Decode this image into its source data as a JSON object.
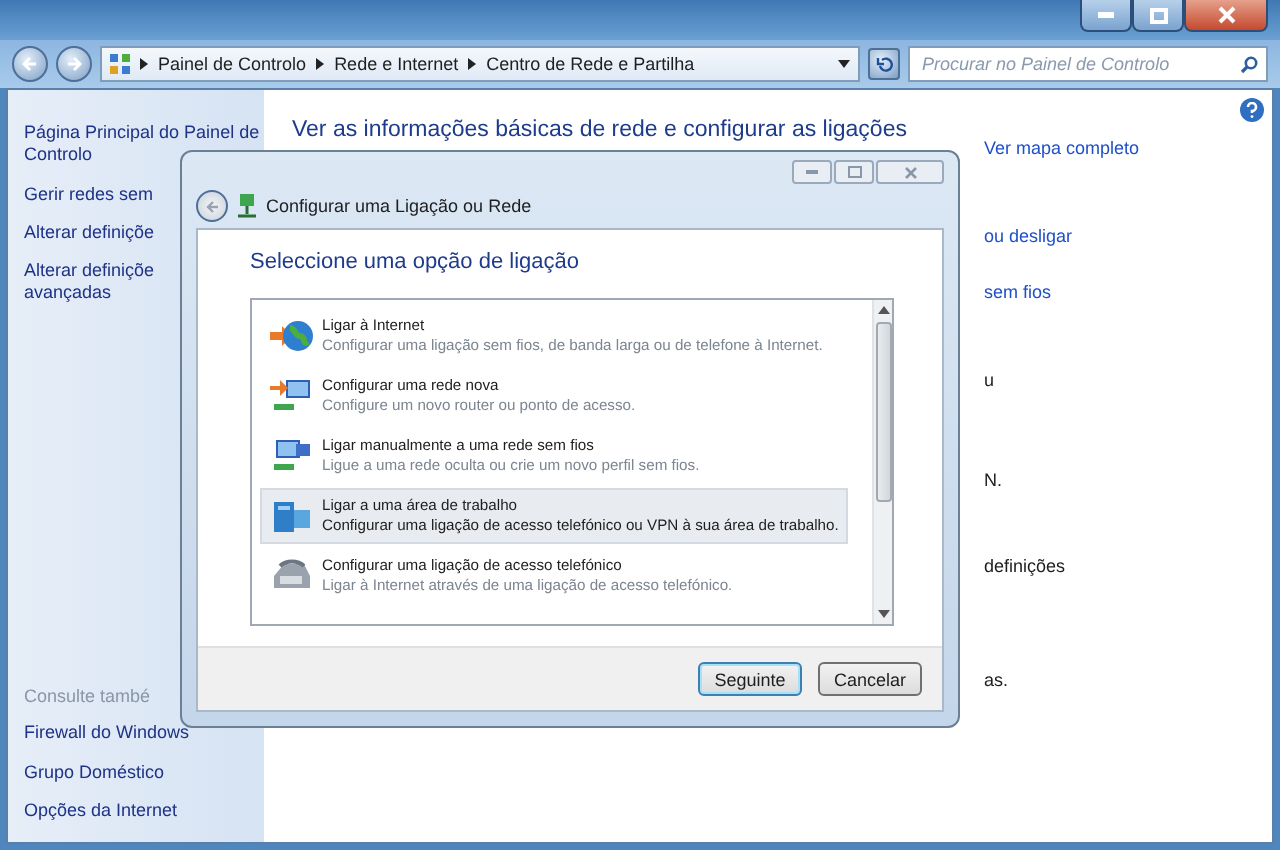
{
  "address_bar": {
    "breadcrumbs": [
      "Painel de Controlo",
      "Rede e Internet",
      "Centro de Rede e Partilha"
    ],
    "search": {
      "placeholder": "Procurar no Painel de Controlo"
    }
  },
  "sidebar": {
    "items": [
      "Página Principal do Painel de Controlo",
      "Gerir redes sem",
      "Alterar definiçõe",
      "Alterar definiçõe avançadas"
    ],
    "see_also": {
      "title": "Consulte també",
      "items": [
        "Firewall do Windows",
        "Grupo Doméstico",
        "Opções da Internet"
      ]
    }
  },
  "main": {
    "heading": "Ver as informações básicas de rede e configurar as ligações",
    "fragments": [
      {
        "text": "Ver mapa completo",
        "kind": "link"
      },
      {
        "text": "ou desligar",
        "kind": "link"
      },
      {
        "text": "sem fios",
        "kind": "link"
      },
      {
        "text": "u",
        "kind": "text"
      },
      {
        "text": "N.",
        "kind": "text"
      },
      {
        "text": "definições",
        "kind": "text"
      },
      {
        "text": "as.",
        "kind": "text"
      }
    ]
  },
  "dialog": {
    "title": "Configurar uma Ligação ou Rede",
    "heading": "Seleccione uma opção de ligação",
    "options": [
      {
        "title": "Ligar à Internet",
        "description": "Configurar uma ligação sem fios, de banda larga ou de telefone à Internet.",
        "selected": false
      },
      {
        "title": "Configurar uma rede nova",
        "description": "Configure um novo router ou ponto de acesso.",
        "selected": false
      },
      {
        "title": "Ligar manualmente a uma rede sem fios",
        "description": "Ligue a uma rede oculta ou crie um novo perfil sem fios.",
        "selected": false
      },
      {
        "title": "Ligar a uma área de trabalho",
        "description": "Configurar uma ligação de acesso telefónico ou VPN à sua área de trabalho.",
        "selected": true
      },
      {
        "title": "Configurar uma ligação de acesso telefónico",
        "description": "Ligar à Internet através de uma ligação de acesso telefónico.",
        "selected": false
      }
    ],
    "buttons": [
      {
        "label": "Seguinte",
        "default": true
      },
      {
        "label": "Cancelar",
        "default": false
      }
    ]
  }
}
